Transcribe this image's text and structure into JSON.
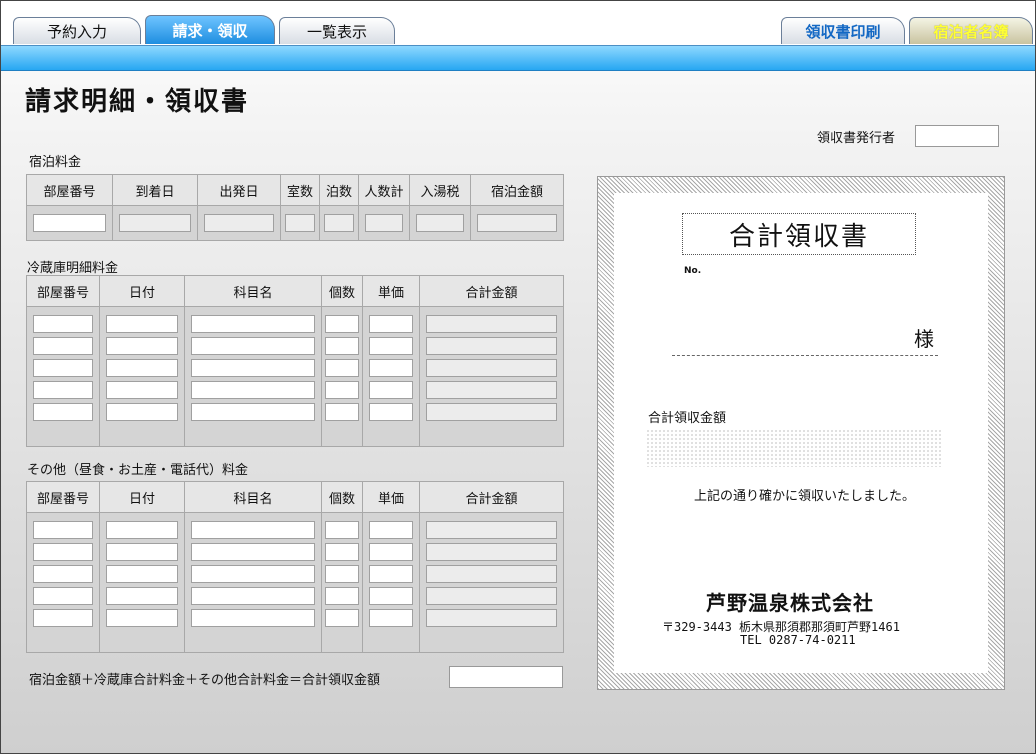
{
  "tabs": {
    "yoyaku": "予約入力",
    "seikyu": "請求・領収",
    "ichiran": "一覧表示",
    "print": "領収書印刷",
    "meibo": "宿泊者名簿"
  },
  "page_title": "請求明細・領収書",
  "issuer_label": "領収書発行者",
  "sections": {
    "stay": "宿泊料金",
    "fridge": "冷蔵庫明細料金",
    "other": "その他（昼食・お土産・電話代）料金"
  },
  "stay_headers": [
    "部屋番号",
    "到着日",
    "出発日",
    "室数",
    "泊数",
    "人数計",
    "入湯税",
    "宿泊金額"
  ],
  "item_headers": [
    "部屋番号",
    "日付",
    "科目名",
    "個数",
    "単価",
    "合計金額"
  ],
  "formula": "宿泊金額＋冷蔵庫合計料金＋その他合計料金＝合計領収金額",
  "receipt": {
    "title": "合計領収書",
    "no": "No.",
    "sama": "様",
    "amount_label": "合計領収金額",
    "message": "上記の通り確かに領収いたしました。",
    "company": "芦野温泉株式会社",
    "address": "〒329-3443 栃木県那須郡那須町芦野1461",
    "tel": "TEL 0287-74-0211"
  }
}
